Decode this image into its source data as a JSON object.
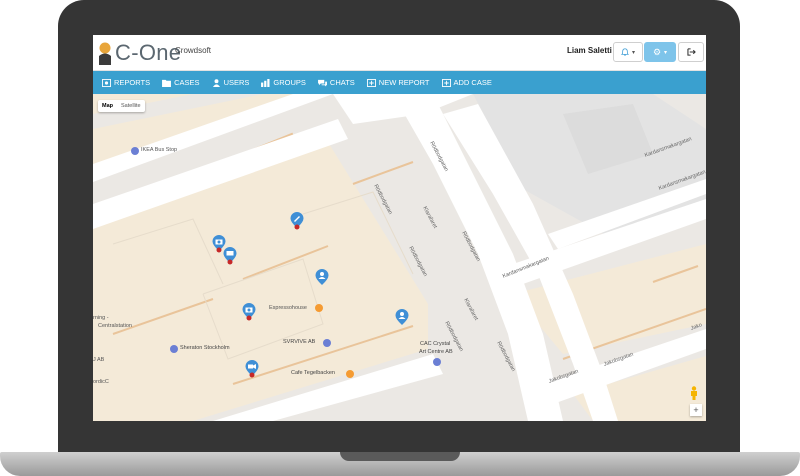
{
  "app": {
    "logo_text": "C-One",
    "org": "Crowdsoft"
  },
  "header": {
    "user_name": "Liam Saletti"
  },
  "nav": [
    {
      "label": "REPORTS"
    },
    {
      "label": "CASES"
    },
    {
      "label": "USERS"
    },
    {
      "label": "GROUPS"
    },
    {
      "label": "CHATS"
    },
    {
      "label": "NEW REPORT"
    },
    {
      "label": "ADD CASE"
    }
  ],
  "map": {
    "type_map": "Map",
    "type_satellite": "Satellite",
    "places": {
      "ikea": "IKEA Bus Stop",
      "espresso": "Espressohouse",
      "sheraton": "Sheraton Stockholm",
      "svrvive": "SVRVIVE AB",
      "cac1": "CAC Crystal",
      "cac2": "Art Centre AB",
      "cafe": "Cafe Tegelbacken",
      "rning": "rning -",
      "central": "Centralstation",
      "jab": "J AB",
      "nordic": "ordicC"
    },
    "streets": {
      "rodbod1": "Rödbodgatan",
      "rodbod2": "Rödbodgatan",
      "rodbod3": "Rödbodgatan",
      "rodbod4": "Rödbodgatan",
      "rodbod5": "Rödbodgatan",
      "rodbod6": "Rödbodgatan",
      "klara1": "Klarafaret",
      "klara2": "Klarafaret",
      "kard1": "Kardansmakargatan",
      "kard2": "Kardansmakargatan",
      "kard3": "Kardansmakargatan",
      "jakob1": "Jakobsgatan",
      "jakob2": "Jakobsgatan",
      "jako3": "Jako"
    },
    "zoom_in": "+"
  },
  "colors": {
    "nav_bg": "#3aa0cf",
    "pin_blue": "#3f8fd6",
    "pin_badge": "#c62828"
  }
}
